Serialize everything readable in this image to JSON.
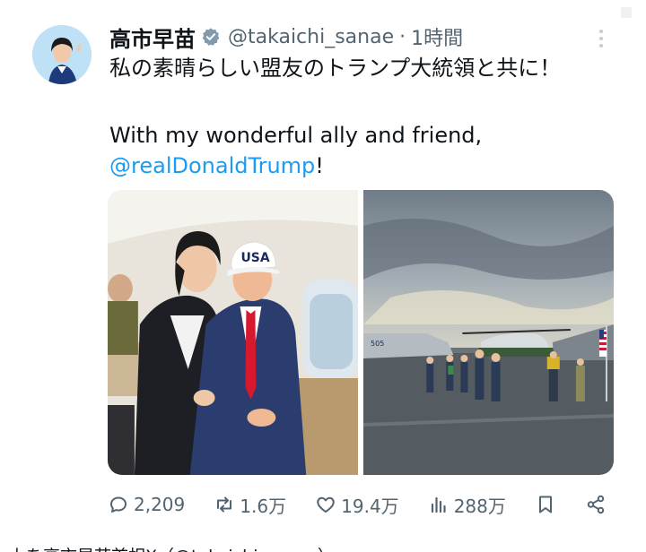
{
  "post": {
    "display_name": "高市早苗",
    "handle": "@takaichi_sanae",
    "separator": "·",
    "time": "1時間",
    "text_jp": "私の素晴らしい盟友のトランプ大統領と共に！",
    "text_en": "With my wonderful ally and friend,",
    "mention": "@realDonaldTrump",
    "mention_suffix": "!",
    "accent_color": "#1d9bf0",
    "verified_color": "#829aab"
  },
  "media": {
    "photo1": {
      "cap_text": "USA"
    },
    "photo2": {
      "plane_marking": "505"
    }
  },
  "actions": {
    "reply_count": "2,209",
    "repost_count": "1.6万",
    "like_count": "19.4万",
    "view_count": "288万",
    "icons": [
      "reply-icon",
      "repost-icon",
      "like-icon",
      "views-icon",
      "bookmark-icon",
      "share-icon"
    ]
  },
  "caption": {
    "text": "上を高市早苗首相X（@takaichi_sanae）"
  }
}
